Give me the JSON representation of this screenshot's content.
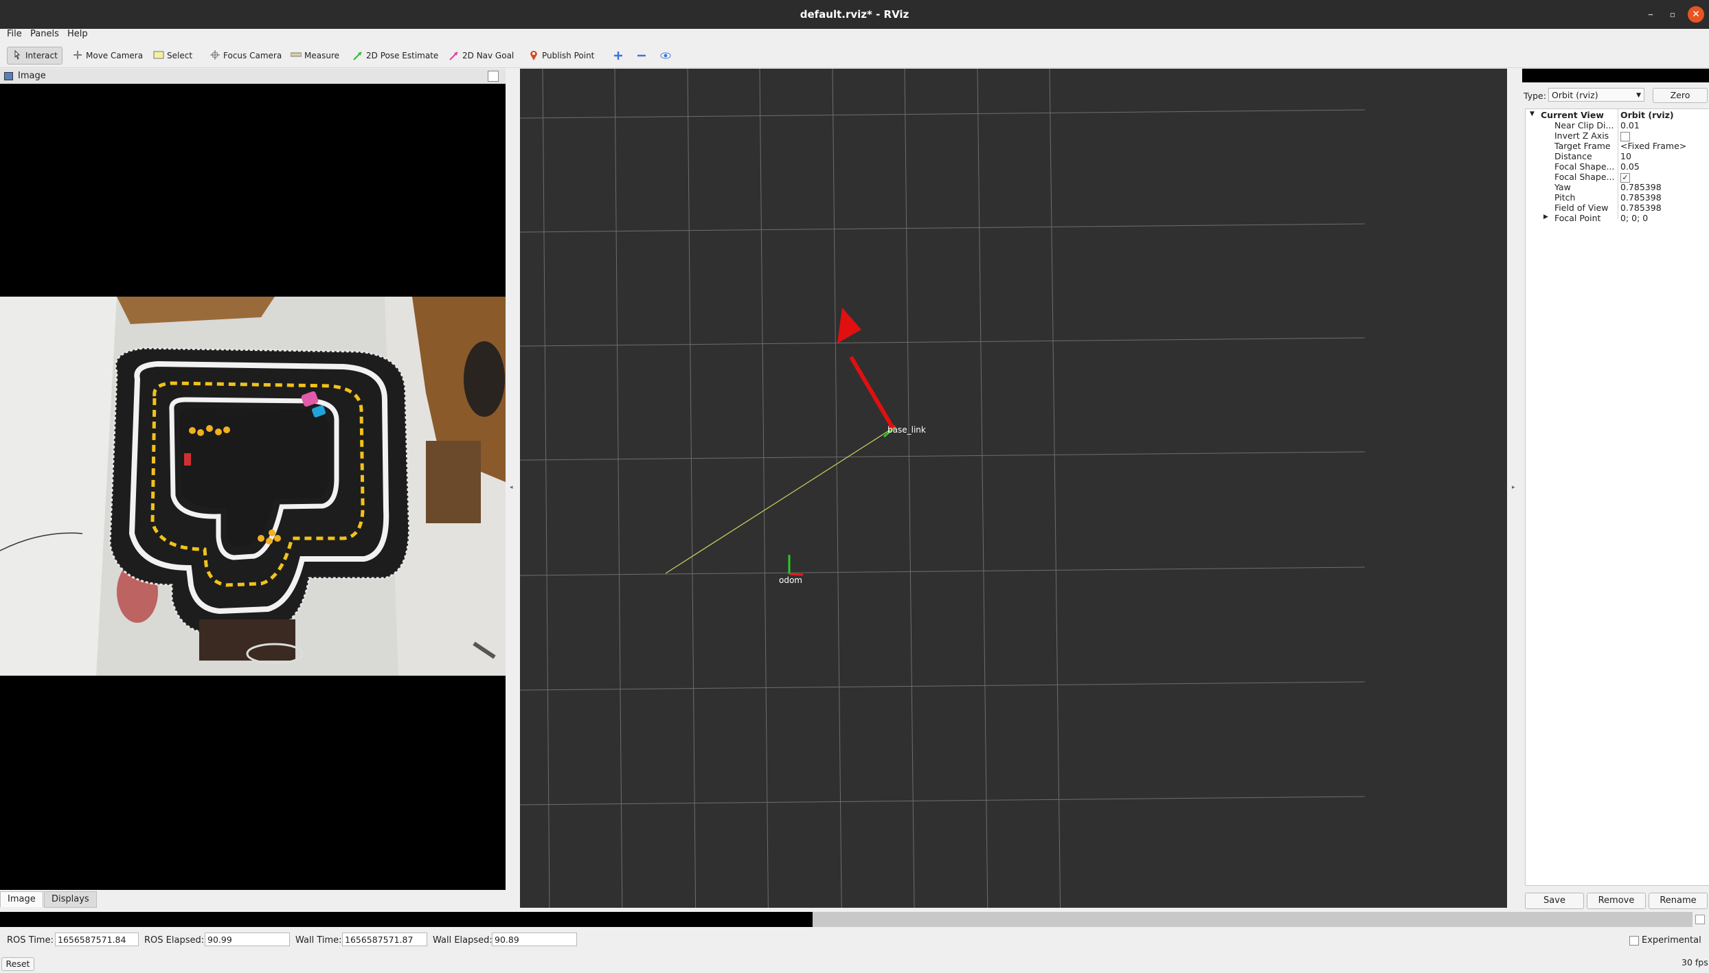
{
  "window": {
    "title": "default.rviz* - RViz"
  },
  "menubar": {
    "items": [
      "File",
      "Panels",
      "Help"
    ]
  },
  "toolbar": {
    "tools": [
      {
        "label": "Interact",
        "icon": "cursor-hand-icon",
        "active": true
      },
      {
        "label": "Move Camera",
        "icon": "move-camera-icon"
      },
      {
        "label": "Select",
        "icon": "select-box-icon"
      },
      {
        "label": "Focus Camera",
        "icon": "focus-crosshair-icon"
      },
      {
        "label": "Measure",
        "icon": "ruler-icon"
      },
      {
        "label": "2D Pose Estimate",
        "icon": "green-arrow-icon"
      },
      {
        "label": "2D Nav Goal",
        "icon": "pink-arrow-icon"
      },
      {
        "label": "Publish Point",
        "icon": "map-pin-icon"
      }
    ],
    "extra_icons": [
      "add-tool-icon",
      "remove-tool-icon",
      "eye-icon"
    ]
  },
  "image_panel": {
    "title": "Image"
  },
  "bottom_tabs": [
    "Image",
    "Displays"
  ],
  "viewport": {
    "frame_labels": {
      "odom": "odom",
      "base_link": "base_link"
    },
    "colors": {
      "grid": "#a0a0a0",
      "background": "#303030",
      "arrow": "#e01010",
      "link": "#c8c860"
    }
  },
  "views_panel": {
    "type_label": "Type:",
    "type_value": "Orbit (rviz)",
    "zero_button": "Zero",
    "group": {
      "name": "Current View",
      "value": "Orbit (rviz)"
    },
    "properties": [
      {
        "name": "Near Clip Di...",
        "value": "0.01"
      },
      {
        "name": "Invert Z Axis",
        "value": "",
        "checkbox": false
      },
      {
        "name": "Target Frame",
        "value": "<Fixed Frame>"
      },
      {
        "name": "Distance",
        "value": "10"
      },
      {
        "name": "Focal Shape...",
        "value": "0.05"
      },
      {
        "name": "Focal Shape...",
        "value": "",
        "checkbox": true
      },
      {
        "name": "Yaw",
        "value": "0.785398"
      },
      {
        "name": "Pitch",
        "value": "0.785398"
      },
      {
        "name": "Field of View",
        "value": "0.785398"
      },
      {
        "name": "Focal Point",
        "value": "0; 0; 0",
        "expandable": true
      }
    ],
    "buttons": [
      "Save",
      "Remove",
      "Rename"
    ]
  },
  "timebar": {
    "ros_time_label": "ROS Time:",
    "ros_time": "1656587571.84",
    "ros_elapsed_label": "ROS Elapsed:",
    "ros_elapsed": "90.99",
    "wall_time_label": "Wall Time:",
    "wall_time": "1656587571.87",
    "wall_elapsed_label": "Wall Elapsed:",
    "wall_elapsed": "90.89",
    "experimental_label": "Experimental",
    "reset_label": "Reset",
    "fps": "30 fps"
  },
  "progress": {
    "fraction": 0.48
  }
}
